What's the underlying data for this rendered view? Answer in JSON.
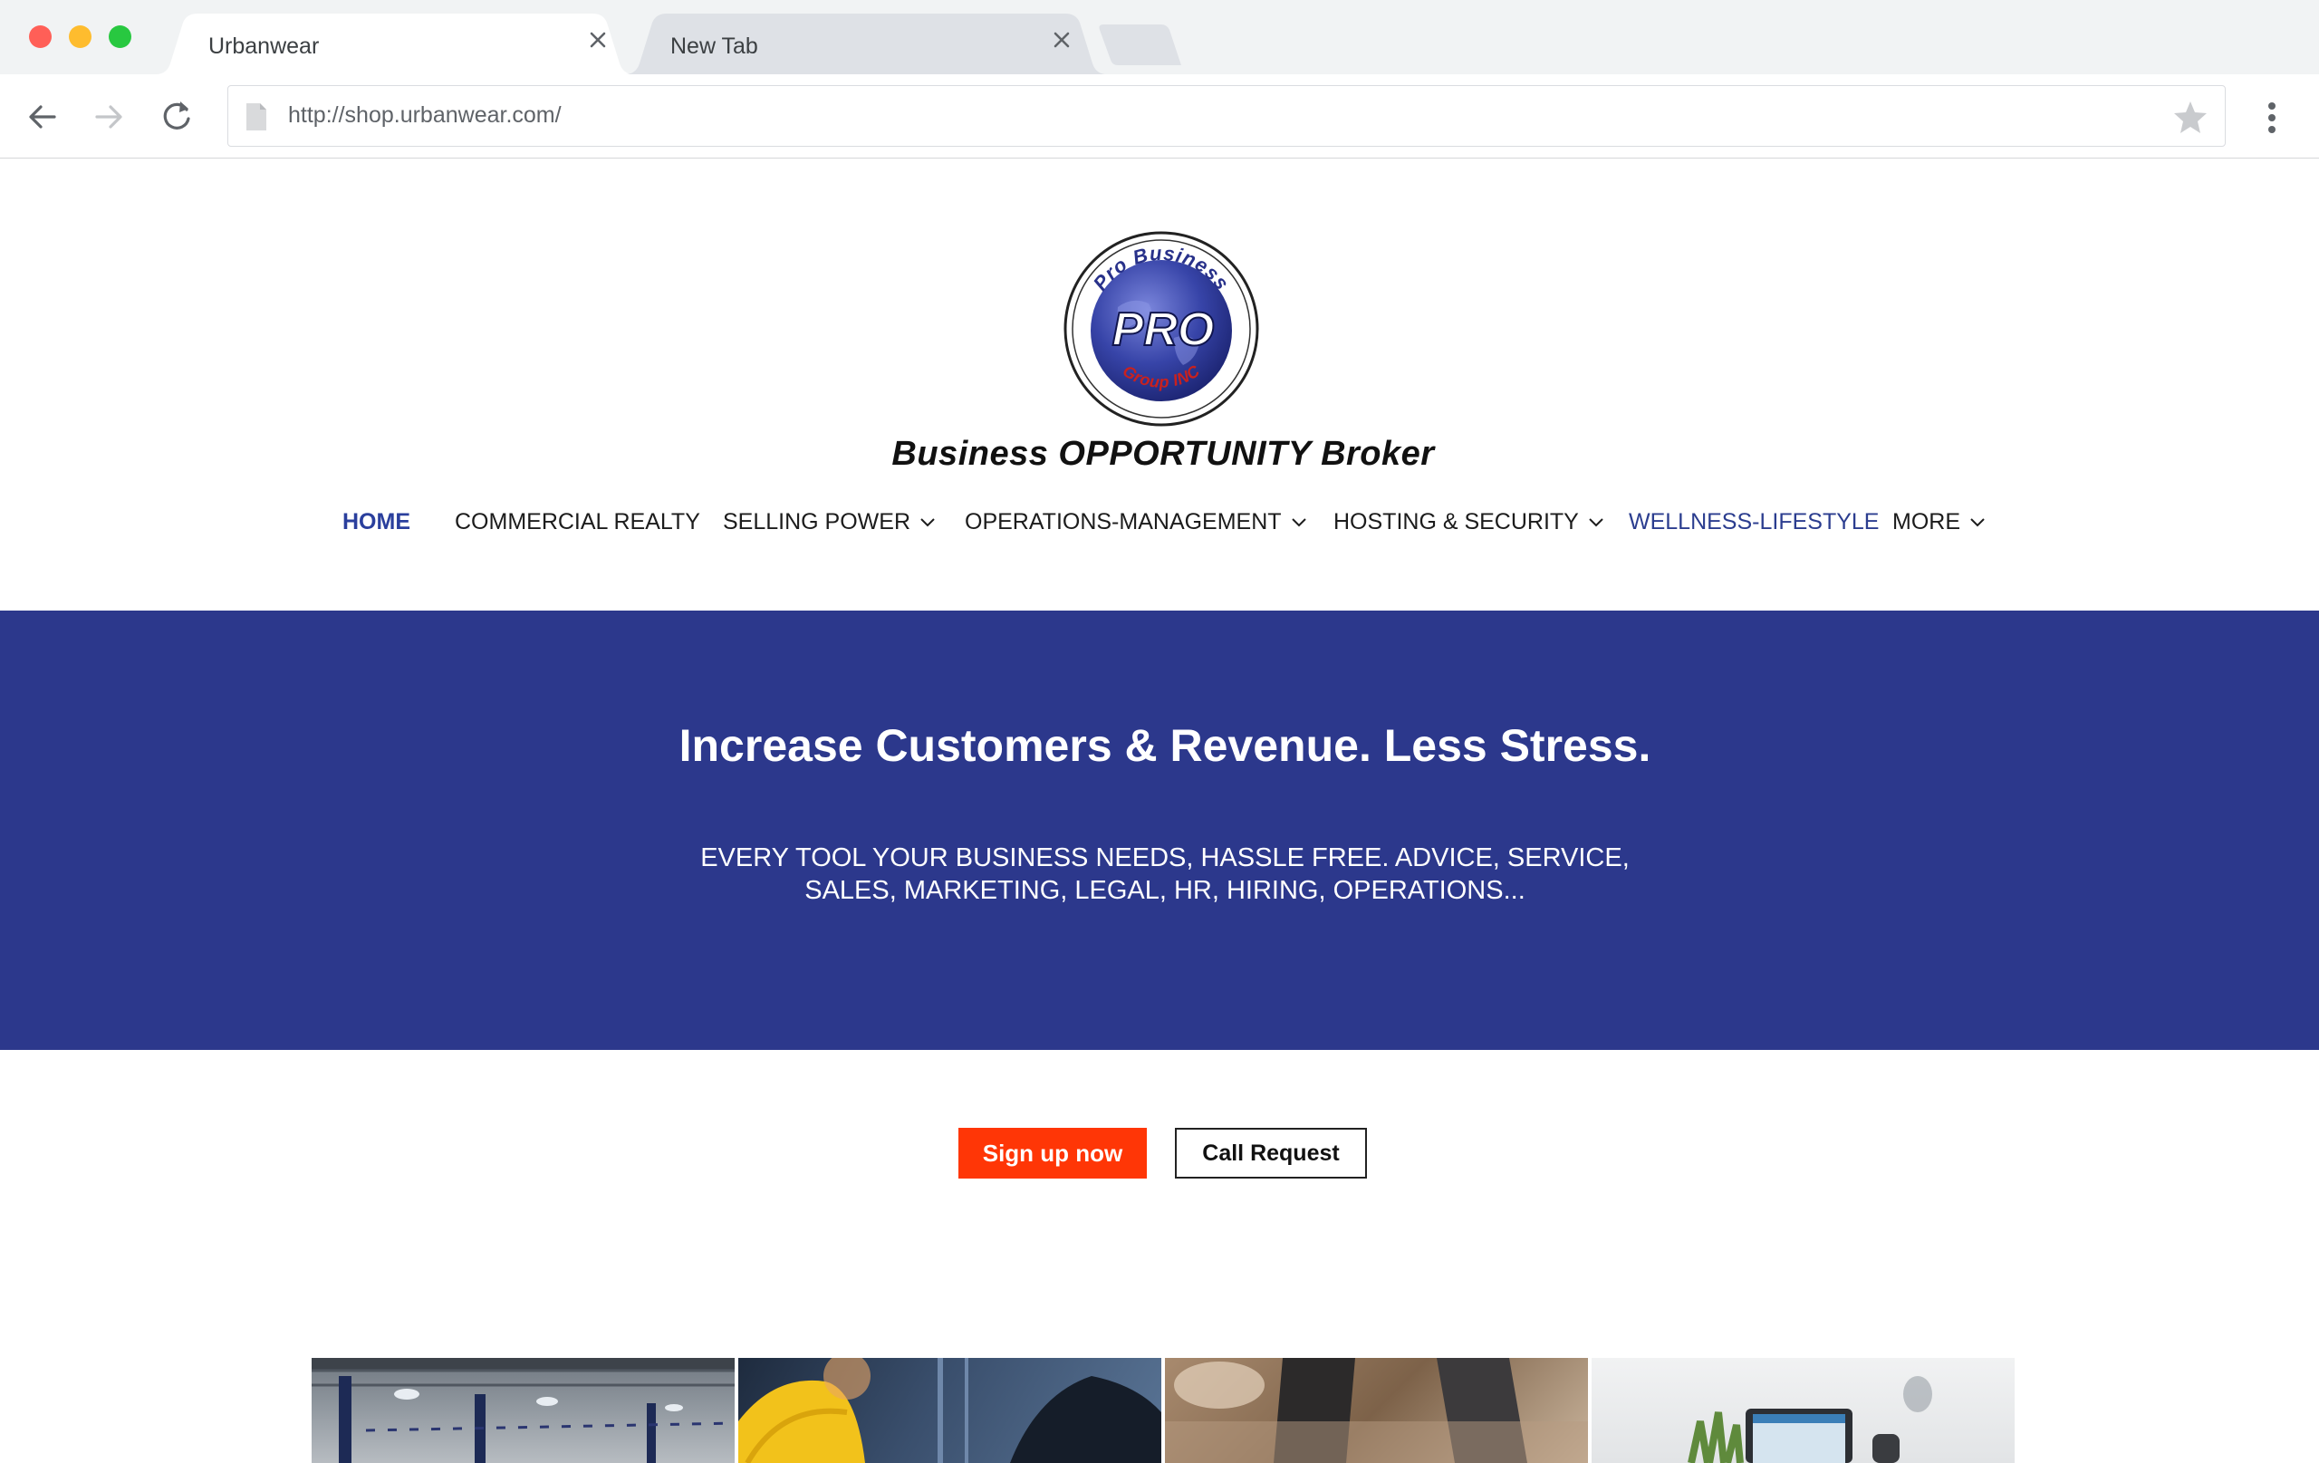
{
  "browser": {
    "tabs": [
      {
        "title": "Urbanwear",
        "active": true
      },
      {
        "title": "New Tab",
        "active": false
      }
    ],
    "url": "http://shop.urbanwear.com/",
    "traffic_light_colors": [
      "#ff5f57",
      "#febc2e",
      "#28c840"
    ]
  },
  "site": {
    "logo": {
      "arc_top": "Pro Business",
      "center": "PRO",
      "arc_bottom": "Group INC"
    },
    "tagline": "Business OPPORTUNITY Broker",
    "nav": [
      {
        "label": "HOME",
        "dropdown": false,
        "active": true
      },
      {
        "label": "COMMERCIAL REALTY",
        "dropdown": false
      },
      {
        "label": "SELLING POWER",
        "dropdown": true
      },
      {
        "label": "OPERATIONS-MANAGEMENT",
        "dropdown": true
      },
      {
        "label": "HOSTING & SECURITY",
        "dropdown": true
      },
      {
        "label": "WELLNESS-LIFESTYLE",
        "dropdown": false
      },
      {
        "label": "MORE",
        "dropdown": true
      }
    ],
    "hero": {
      "title": "Increase Customers & Revenue. Less Stress.",
      "subtitle_line1": "EVERY TOOL YOUR BUSINESS NEEDS, HASSLE FREE. ADVICE, SERVICE,",
      "subtitle_line2": "SALES, MARKETING, LEGAL, HR, HIRING, OPERATIONS...",
      "background": "#2c388c"
    },
    "buttons": {
      "signup": "Sign up now",
      "call": "Call Request"
    },
    "accent_colors": {
      "brand_blue": "#2c388c",
      "signup_orange": "#ff3606"
    }
  }
}
